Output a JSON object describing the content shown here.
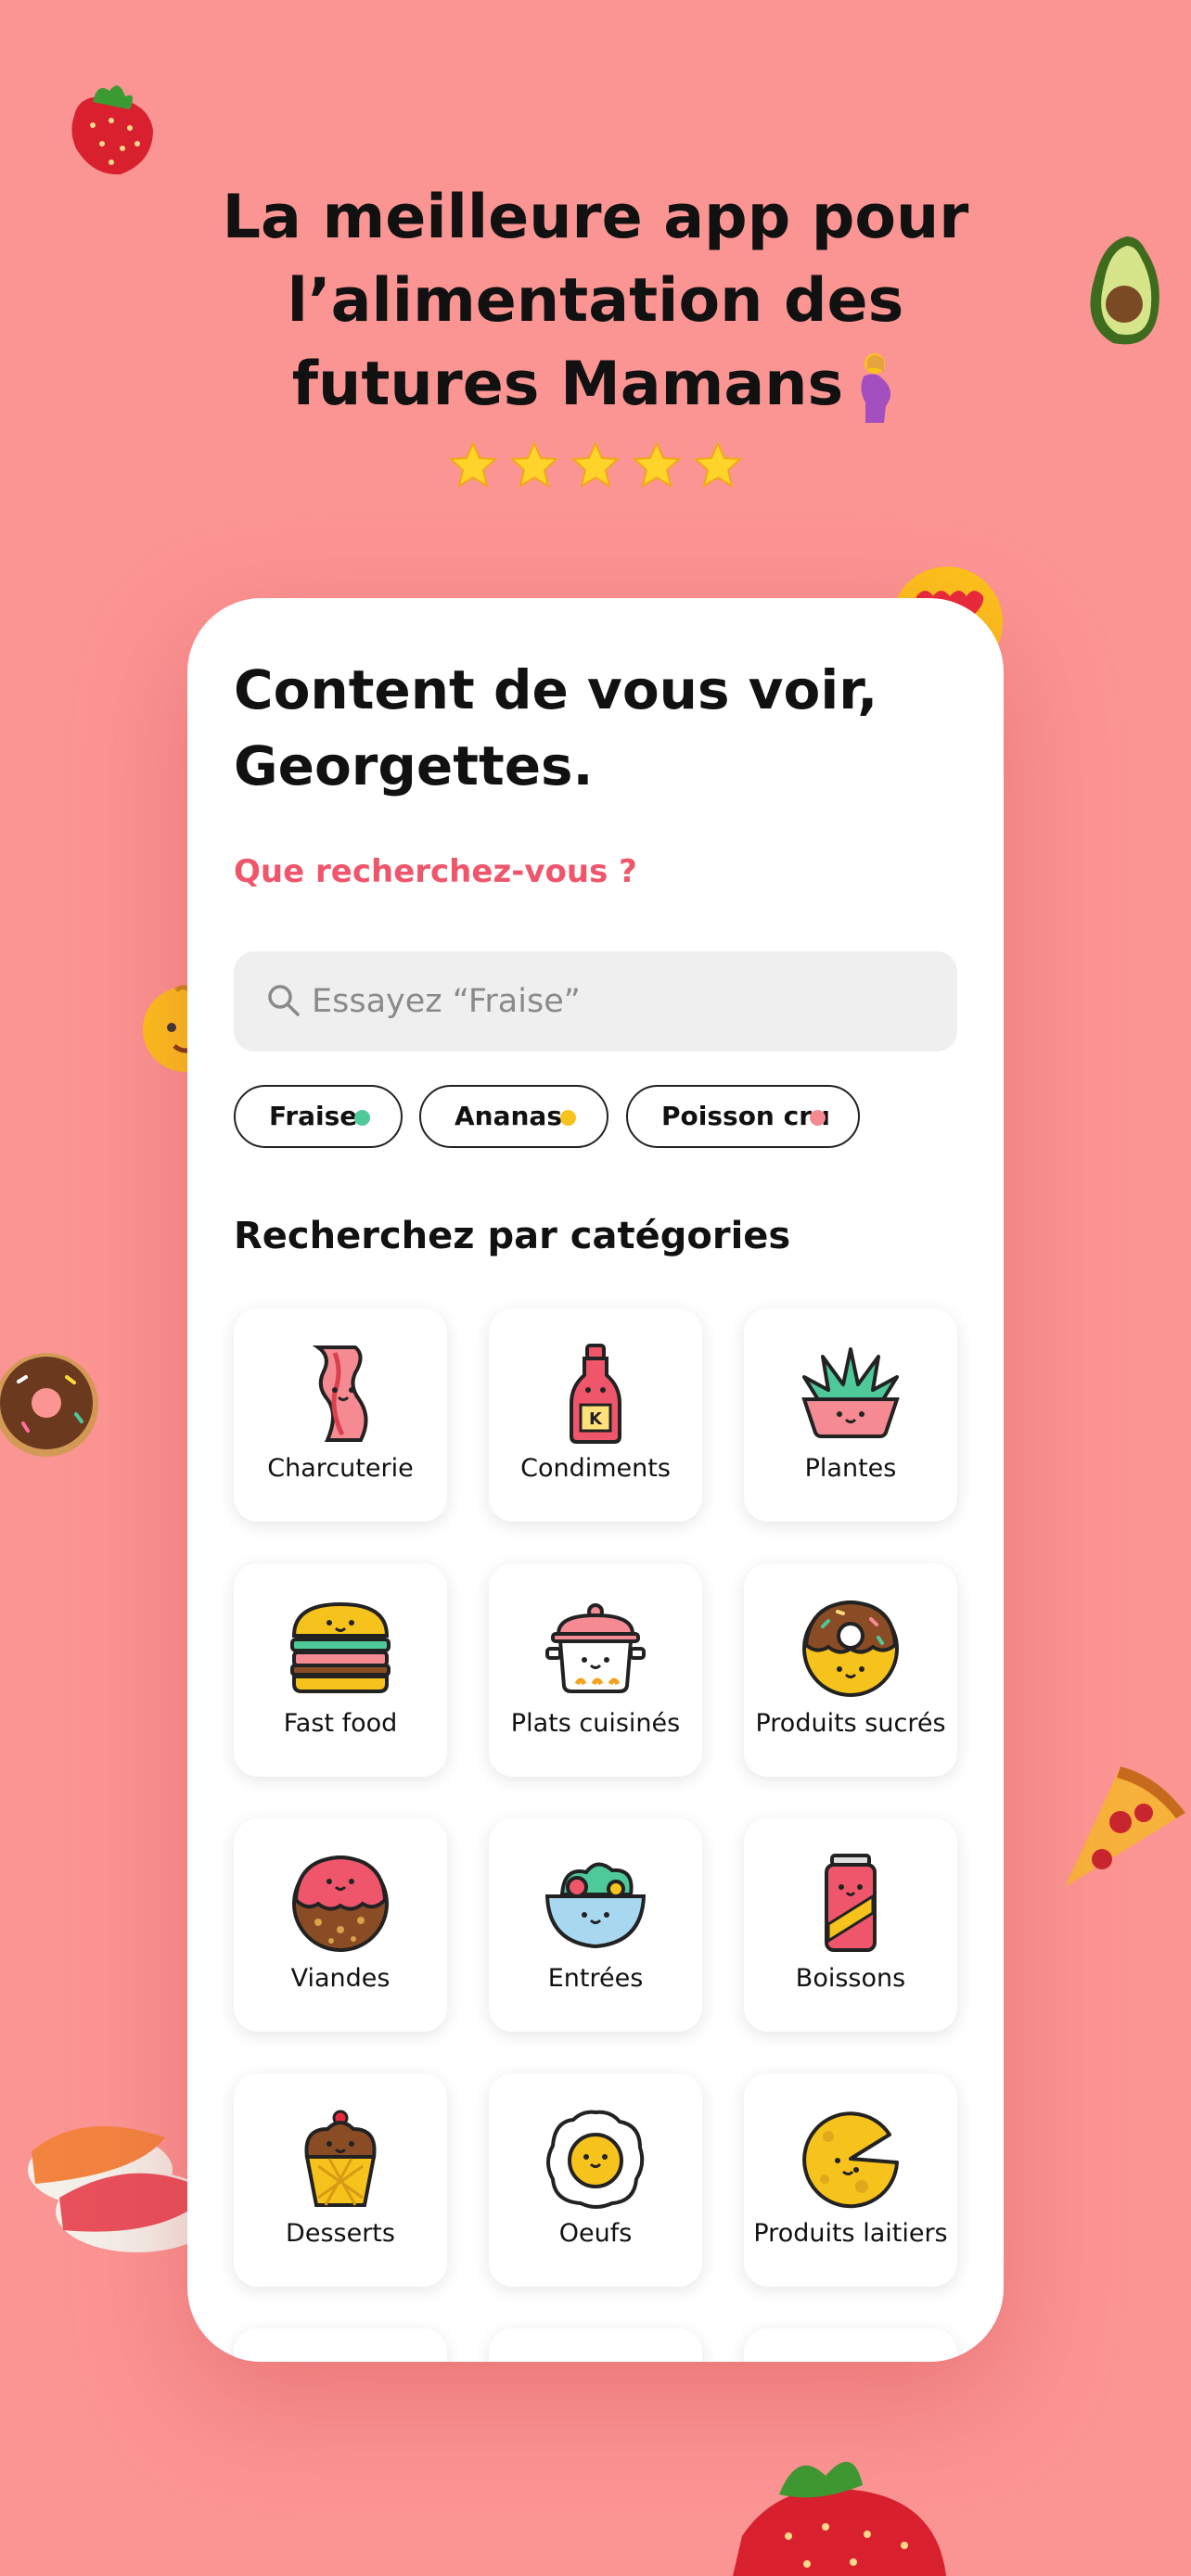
{
  "headline": {
    "line1": "La meilleure app pour",
    "line2": "l’alimentation des",
    "line3": "futures Mamans",
    "rating_stars": 5
  },
  "app": {
    "greeting": "Content de vous voir, Georgettes.",
    "prompt": "Que recherchez-vous ?",
    "search": {
      "placeholder": "Essayez “Fraise”",
      "value": ""
    },
    "chips": [
      {
        "label": "Fraise",
        "dot_color": "#4dc99a"
      },
      {
        "label": "Ananas",
        "dot_color": "#f6c21c"
      },
      {
        "label": "Poisson cru",
        "dot_color": "#f58a93"
      }
    ],
    "categories_title": "Recherchez par catégories",
    "categories": [
      {
        "label": "Charcuterie",
        "icon": "bacon-icon"
      },
      {
        "label": "Condiments",
        "icon": "ketchup-icon"
      },
      {
        "label": "Plantes",
        "icon": "plant-icon"
      },
      {
        "label": "Fast food",
        "icon": "burger-icon"
      },
      {
        "label": "Plats cuisinés",
        "icon": "cooking-pot-icon"
      },
      {
        "label": "Produits sucrés",
        "icon": "donut-icon"
      },
      {
        "label": "Viandes",
        "icon": "meatball-icon"
      },
      {
        "label": "Entrées",
        "icon": "salad-bowl-icon"
      },
      {
        "label": "Boissons",
        "icon": "soda-can-icon"
      },
      {
        "label": "Desserts",
        "icon": "ice-cream-icon"
      },
      {
        "label": "Oeufs",
        "icon": "egg-icon"
      },
      {
        "label": "Produits laitiers",
        "icon": "cheese-icon"
      }
    ]
  },
  "colors": {
    "background": "#fb9593",
    "accent": "#f0566b"
  }
}
